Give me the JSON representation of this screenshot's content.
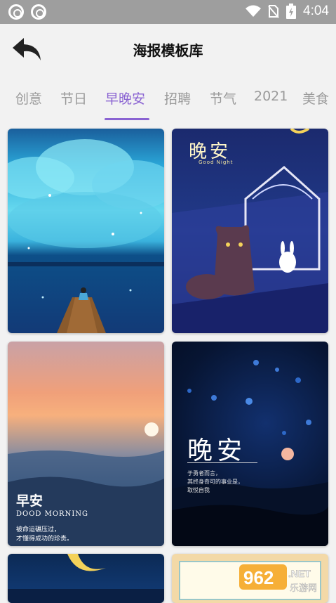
{
  "status_bar": {
    "time": "4:04"
  },
  "header": {
    "title": "海报模板库"
  },
  "tabs": [
    "创意",
    "节日",
    "早晚安",
    "招聘",
    "节气",
    "2021",
    "美食"
  ],
  "active_tab": "早晚安",
  "cards": {
    "c2": {
      "title": "晚安",
      "subtitle": "Good Night"
    },
    "c3": {
      "title": "早安",
      "subtitle": "DOOD MORNING",
      "line1": "被命运碾压过，",
      "line2": "才懂得成功的珍贵。"
    },
    "c4": {
      "title": "晚安",
      "line1": "于勇者而言，",
      "line2": "其终身奇可的事业是，",
      "line3": "取悦自我"
    }
  },
  "watermark": {
    "digits": "962",
    "suffix": ".NET",
    "cn": "乐游网"
  },
  "colors": {
    "accent": "#8a63d2",
    "status_bar": "#9e9e9e",
    "background": "#f2f2f2"
  }
}
